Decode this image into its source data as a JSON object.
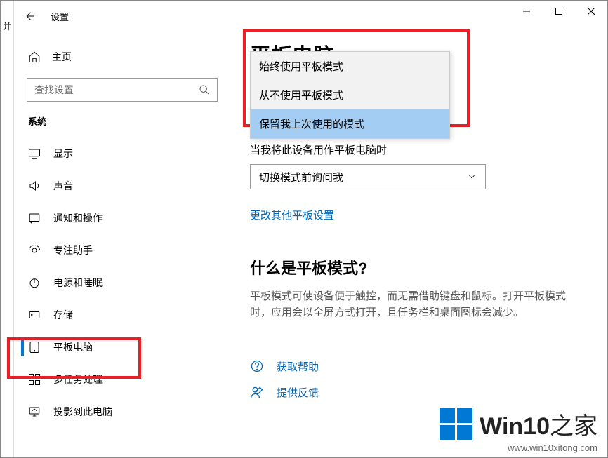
{
  "leftStubChar": "并",
  "titlebar": {
    "backGlyph": "←",
    "title": "设置"
  },
  "winControls": {
    "min": "—",
    "max": "☐",
    "close": "✕"
  },
  "sidebar": {
    "homeLabel": "主页",
    "searchPlaceholder": "查找设置",
    "sectionLabel": "系统",
    "items": [
      {
        "id": "display",
        "label": "显示"
      },
      {
        "id": "sound",
        "label": "声音"
      },
      {
        "id": "notifications",
        "label": "通知和操作"
      },
      {
        "id": "focus",
        "label": "专注助手"
      },
      {
        "id": "power",
        "label": "电源和睡眠"
      },
      {
        "id": "storage",
        "label": "存储"
      },
      {
        "id": "tablet",
        "label": "平板电脑"
      },
      {
        "id": "multitask",
        "label": "多任务处理"
      },
      {
        "id": "project",
        "label": "投影到此电脑"
      }
    ]
  },
  "main": {
    "pageTitle": "平板电脑",
    "dropdownOptions": [
      "始终使用平板模式",
      "从不使用平板模式",
      "保留我上次使用的模式"
    ],
    "dropdownSelectedIndex": 2,
    "subLabel": "当我将此设备用作平板电脑时",
    "select2Value": "切换模式前询问我",
    "moreLink": "更改其他平板设置",
    "whatIsTitle": "什么是平板模式?",
    "whatIsBody": "平板模式可使设备便于触控，而无需借助键盘和鼠标。打开平板模式时，应用会以全屏方式打开，且任务栏和桌面图标会减少。",
    "helpLink": "获取帮助",
    "feedbackLink": "提供反馈"
  },
  "watermark": {
    "brand1": "Win10",
    "brand2": "之家",
    "url": "www.win10xitong.com"
  }
}
